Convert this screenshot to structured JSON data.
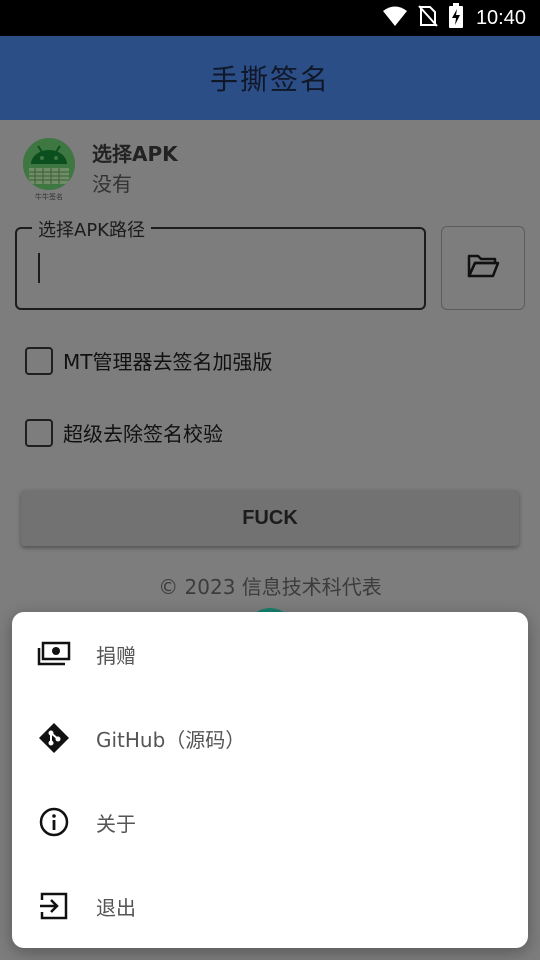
{
  "status_bar": {
    "time": "10:40",
    "icons": [
      "wifi-icon",
      "no-sim-icon",
      "battery-charging-icon"
    ]
  },
  "app_bar": {
    "title": "手撕签名"
  },
  "apk": {
    "title": "选择APK",
    "subtitle": "没有",
    "icon_caption": "牛牛签名"
  },
  "path_field": {
    "label": "选择APK路径",
    "value": ""
  },
  "folder_button": {
    "icon": "folder-open-icon"
  },
  "options": [
    {
      "label": "MT管理器去签名加强版",
      "checked": false
    },
    {
      "label": "超级去除签名校验",
      "checked": false
    }
  ],
  "action_button": {
    "label": "FUCK"
  },
  "footer": {
    "copyright": "© 2023 信息技术科代表"
  },
  "menu": {
    "items": [
      {
        "label": "捐赠",
        "icon": "cash-icon"
      },
      {
        "label": "GitHub（源码）",
        "icon": "git-icon"
      },
      {
        "label": "关于",
        "icon": "info-icon"
      },
      {
        "label": "退出",
        "icon": "exit-icon"
      }
    ]
  }
}
